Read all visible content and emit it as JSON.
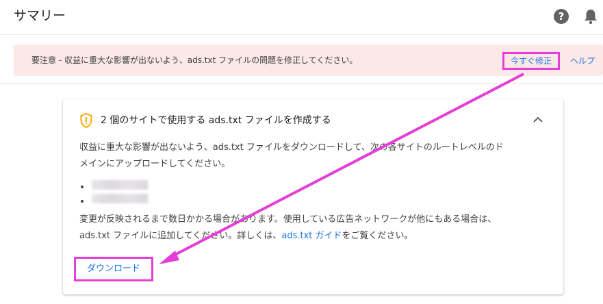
{
  "header": {
    "title": "サマリー",
    "help_icon": "help-circle-icon",
    "notification_icon": "bell-icon"
  },
  "alert": {
    "text": "要注意 - 収益に重大な影響が出ないよう、ads.txt ファイルの問題を修正してください。",
    "fix_label": "今すぐ修正",
    "help_label": "ヘルプ",
    "background": "#fce8e6"
  },
  "card": {
    "icon": "warning-shield-icon",
    "title": "2 個のサイトで使用する ads.txt ファイルを作成する",
    "para1_line1": "収益に重大な影響が出ないよう、ads.txt ファイルをダウンロードして、次の各サイトのルートレベルのド",
    "para1_line2": "メインにアップロードしてください。",
    "para2_line1": "変更が反映されるまで数日かかる場合があります。使用している広告ネットワークが他にもある場合は、",
    "para2_line2_prefix": "ads.txt ファイルに追加してください。詳しくは、",
    "ads_guide_link": "ads.txt ガイド",
    "para2_line2_suffix": "をご覧ください。",
    "download_label": "ダウンロード"
  },
  "colors": {
    "link": "#1a73e8",
    "highlight": "#e53ed6",
    "warning": "#f9ab00"
  }
}
